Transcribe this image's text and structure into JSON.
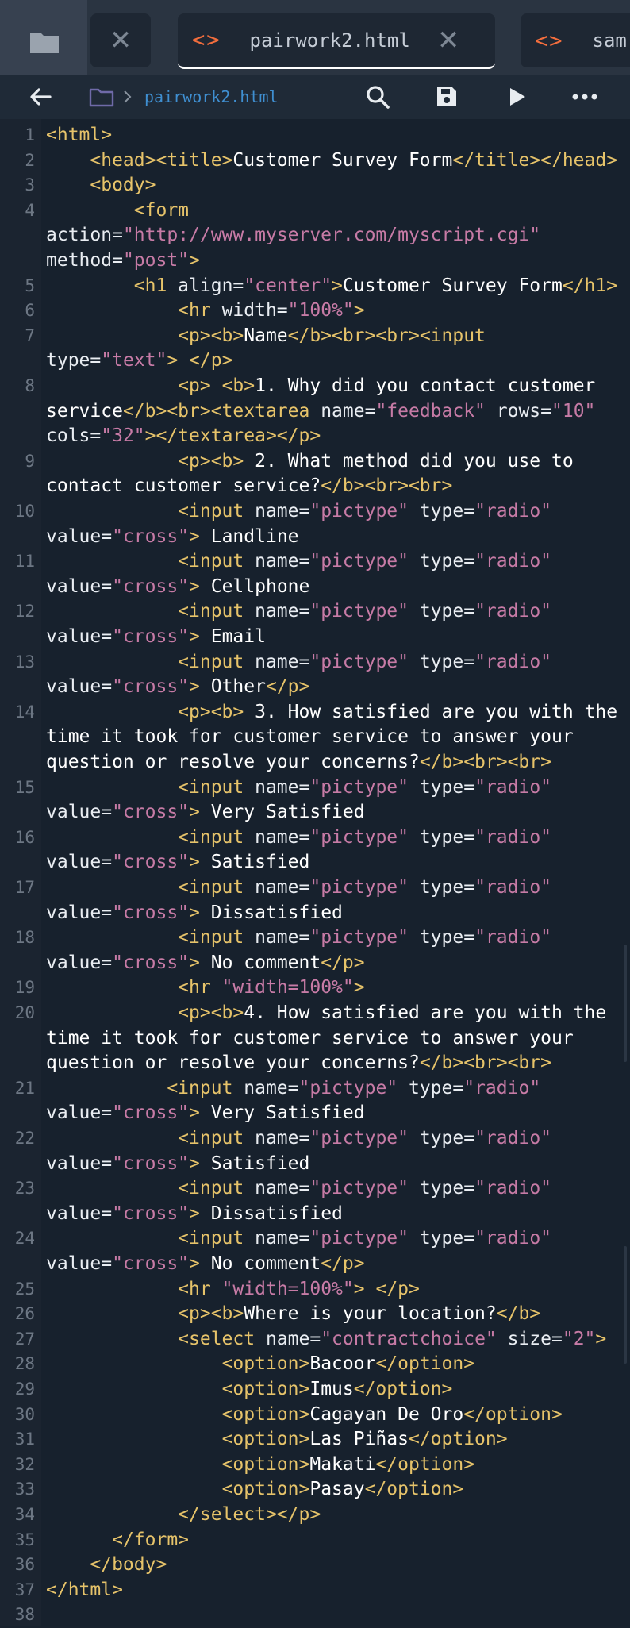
{
  "tabs": [
    {
      "label": "pairwork2.html",
      "active": true
    },
    {
      "label": "sam",
      "active": false
    }
  ],
  "toolbar": {
    "breadcrumb_label": "pairwork2.html"
  },
  "editor": {
    "lines": [
      {
        "n": "1",
        "tokens": [
          [
            "t",
            "<html>"
          ]
        ]
      },
      {
        "n": "2",
        "tokens": [
          [
            "x",
            "    "
          ],
          [
            "t",
            "<head><title>"
          ],
          [
            "x",
            "Customer Survey Form"
          ],
          [
            "t",
            "</title></head>"
          ]
        ]
      },
      {
        "n": "3",
        "tokens": [
          [
            "x",
            "    "
          ],
          [
            "t",
            "<body>"
          ]
        ]
      },
      {
        "n": "4",
        "tokens": [
          [
            "x",
            "        "
          ],
          [
            "t",
            "<form"
          ],
          [
            "x",
            "\n"
          ],
          [
            "a",
            "action="
          ],
          [
            "s",
            "\"http://www.myserver.com/myscript.cgi\""
          ],
          [
            "x",
            "\n"
          ],
          [
            "a",
            "method="
          ],
          [
            "s",
            "\"post\""
          ],
          [
            "t",
            ">"
          ]
        ]
      },
      {
        "n": "5",
        "tokens": [
          [
            "x",
            "        "
          ],
          [
            "t",
            "<h1"
          ],
          [
            "a",
            " align="
          ],
          [
            "s",
            "\"center\""
          ],
          [
            "t",
            ">"
          ],
          [
            "x",
            "Customer Survey Form"
          ],
          [
            "t",
            "</h1>"
          ]
        ]
      },
      {
        "n": "6",
        "tokens": [
          [
            "x",
            "            "
          ],
          [
            "t",
            "<hr"
          ],
          [
            "a",
            " width="
          ],
          [
            "s",
            "\"100%\""
          ],
          [
            "t",
            ">"
          ]
        ]
      },
      {
        "n": "7",
        "tokens": [
          [
            "x",
            "            "
          ],
          [
            "t",
            "<p><b>"
          ],
          [
            "x",
            "Name"
          ],
          [
            "t",
            "</b><br><br><input"
          ],
          [
            "x",
            "\n"
          ],
          [
            "a",
            "type="
          ],
          [
            "s",
            "\"text\""
          ],
          [
            "t",
            ">"
          ],
          [
            "x",
            " "
          ],
          [
            "t",
            "</p>"
          ]
        ]
      },
      {
        "n": "8",
        "tokens": [
          [
            "x",
            "            "
          ],
          [
            "t",
            "<p>"
          ],
          [
            "x",
            " "
          ],
          [
            "t",
            "<b>"
          ],
          [
            "x",
            "1. Why did you contact customer service"
          ],
          [
            "t",
            "</b><br><textarea"
          ],
          [
            "a",
            " name="
          ],
          [
            "s",
            "\"feedback\""
          ],
          [
            "a",
            " rows="
          ],
          [
            "s",
            "\"10\""
          ],
          [
            "x",
            "\n"
          ],
          [
            "a",
            "cols="
          ],
          [
            "s",
            "\"32\""
          ],
          [
            "t",
            "></textarea></p>"
          ]
        ]
      },
      {
        "n": "9",
        "tokens": [
          [
            "x",
            "            "
          ],
          [
            "t",
            "<p><b>"
          ],
          [
            "x",
            " 2. What method did you use to contact customer service?"
          ],
          [
            "t",
            "</b><br><br>"
          ]
        ]
      },
      {
        "n": "10",
        "tokens": [
          [
            "x",
            "            "
          ],
          [
            "t",
            "<input"
          ],
          [
            "a",
            " name="
          ],
          [
            "s",
            "\"pictype\""
          ],
          [
            "a",
            " type="
          ],
          [
            "s",
            "\"radio\""
          ],
          [
            "x",
            "\n"
          ],
          [
            "a",
            "value="
          ],
          [
            "s",
            "\"cross\""
          ],
          [
            "t",
            ">"
          ],
          [
            "x",
            " Landline"
          ]
        ]
      },
      {
        "n": "11",
        "tokens": [
          [
            "x",
            "            "
          ],
          [
            "t",
            "<input"
          ],
          [
            "a",
            " name="
          ],
          [
            "s",
            "\"pictype\""
          ],
          [
            "a",
            " type="
          ],
          [
            "s",
            "\"radio\""
          ],
          [
            "x",
            "\n"
          ],
          [
            "a",
            "value="
          ],
          [
            "s",
            "\"cross\""
          ],
          [
            "t",
            ">"
          ],
          [
            "x",
            " Cellphone"
          ]
        ]
      },
      {
        "n": "12",
        "tokens": [
          [
            "x",
            "            "
          ],
          [
            "t",
            "<input"
          ],
          [
            "a",
            " name="
          ],
          [
            "s",
            "\"pictype\""
          ],
          [
            "a",
            " type="
          ],
          [
            "s",
            "\"radio\""
          ],
          [
            "x",
            "\n"
          ],
          [
            "a",
            "value="
          ],
          [
            "s",
            "\"cross\""
          ],
          [
            "t",
            ">"
          ],
          [
            "x",
            " Email"
          ]
        ]
      },
      {
        "n": "13",
        "tokens": [
          [
            "x",
            "            "
          ],
          [
            "t",
            "<input"
          ],
          [
            "a",
            " name="
          ],
          [
            "s",
            "\"pictype\""
          ],
          [
            "a",
            " type="
          ],
          [
            "s",
            "\"radio\""
          ],
          [
            "x",
            "\n"
          ],
          [
            "a",
            "value="
          ],
          [
            "s",
            "\"cross\""
          ],
          [
            "t",
            ">"
          ],
          [
            "x",
            " Other"
          ],
          [
            "t",
            "</p>"
          ]
        ]
      },
      {
        "n": "14",
        "tokens": [
          [
            "x",
            "            "
          ],
          [
            "t",
            "<p><b>"
          ],
          [
            "x",
            " 3. How satisfied are you with the time it took for customer service to answer your question or resolve your concerns?"
          ],
          [
            "t",
            "</b><br><br>"
          ]
        ]
      },
      {
        "n": "15",
        "tokens": [
          [
            "x",
            "            "
          ],
          [
            "t",
            "<input"
          ],
          [
            "a",
            " name="
          ],
          [
            "s",
            "\"pictype\""
          ],
          [
            "a",
            " type="
          ],
          [
            "s",
            "\"radio\""
          ],
          [
            "x",
            "\n"
          ],
          [
            "a",
            "value="
          ],
          [
            "s",
            "\"cross\""
          ],
          [
            "t",
            ">"
          ],
          [
            "x",
            " Very Satisfied"
          ]
        ]
      },
      {
        "n": "16",
        "tokens": [
          [
            "x",
            "            "
          ],
          [
            "t",
            "<input"
          ],
          [
            "a",
            " name="
          ],
          [
            "s",
            "\"pictype\""
          ],
          [
            "a",
            " type="
          ],
          [
            "s",
            "\"radio\""
          ],
          [
            "x",
            "\n"
          ],
          [
            "a",
            "value="
          ],
          [
            "s",
            "\"cross\""
          ],
          [
            "t",
            ">"
          ],
          [
            "x",
            " Satisfied"
          ]
        ]
      },
      {
        "n": "17",
        "tokens": [
          [
            "x",
            "            "
          ],
          [
            "t",
            "<input"
          ],
          [
            "a",
            " name="
          ],
          [
            "s",
            "\"pictype\""
          ],
          [
            "a",
            " type="
          ],
          [
            "s",
            "\"radio\""
          ],
          [
            "x",
            "\n"
          ],
          [
            "a",
            "value="
          ],
          [
            "s",
            "\"cross\""
          ],
          [
            "t",
            ">"
          ],
          [
            "x",
            " Dissatisfied"
          ]
        ]
      },
      {
        "n": "18",
        "tokens": [
          [
            "x",
            "            "
          ],
          [
            "t",
            "<input"
          ],
          [
            "a",
            " name="
          ],
          [
            "s",
            "\"pictype\""
          ],
          [
            "a",
            " type="
          ],
          [
            "s",
            "\"radio\""
          ],
          [
            "x",
            "\n"
          ],
          [
            "a",
            "value="
          ],
          [
            "s",
            "\"cross\""
          ],
          [
            "t",
            ">"
          ],
          [
            "x",
            " No comment"
          ],
          [
            "t",
            "</p>"
          ]
        ]
      },
      {
        "n": "19",
        "tokens": [
          [
            "x",
            "            "
          ],
          [
            "t",
            "<hr"
          ],
          [
            "x",
            " "
          ],
          [
            "s",
            "\"width=100%\""
          ],
          [
            "t",
            ">"
          ]
        ]
      },
      {
        "n": "20",
        "tokens": [
          [
            "x",
            "            "
          ],
          [
            "t",
            "<p><b>"
          ],
          [
            "x",
            "4. How satisfied are you with the time it took for customer service to answer your question or resolve your concerns?"
          ],
          [
            "t",
            "</b><br><br>"
          ]
        ]
      },
      {
        "n": "21",
        "tokens": [
          [
            "x",
            "           "
          ],
          [
            "t",
            "<input"
          ],
          [
            "a",
            " name="
          ],
          [
            "s",
            "\"pictype\""
          ],
          [
            "a",
            " type="
          ],
          [
            "s",
            "\"radio\""
          ],
          [
            "x",
            "\n"
          ],
          [
            "a",
            "value="
          ],
          [
            "s",
            "\"cross\""
          ],
          [
            "t",
            ">"
          ],
          [
            "x",
            " Very Satisfied"
          ]
        ]
      },
      {
        "n": "22",
        "tokens": [
          [
            "x",
            "            "
          ],
          [
            "t",
            "<input"
          ],
          [
            "a",
            " name="
          ],
          [
            "s",
            "\"pictype\""
          ],
          [
            "a",
            " type="
          ],
          [
            "s",
            "\"radio\""
          ],
          [
            "x",
            "\n"
          ],
          [
            "a",
            "value="
          ],
          [
            "s",
            "\"cross\""
          ],
          [
            "t",
            ">"
          ],
          [
            "x",
            " Satisfied"
          ]
        ]
      },
      {
        "n": "23",
        "tokens": [
          [
            "x",
            "            "
          ],
          [
            "t",
            "<input"
          ],
          [
            "a",
            " name="
          ],
          [
            "s",
            "\"pictype\""
          ],
          [
            "a",
            " type="
          ],
          [
            "s",
            "\"radio\""
          ],
          [
            "x",
            "\n"
          ],
          [
            "a",
            "value="
          ],
          [
            "s",
            "\"cross\""
          ],
          [
            "t",
            ">"
          ],
          [
            "x",
            " Dissatisfied"
          ]
        ]
      },
      {
        "n": "24",
        "tokens": [
          [
            "x",
            "            "
          ],
          [
            "t",
            "<input"
          ],
          [
            "a",
            " name="
          ],
          [
            "s",
            "\"pictype\""
          ],
          [
            "a",
            " type="
          ],
          [
            "s",
            "\"radio\""
          ],
          [
            "x",
            "\n"
          ],
          [
            "a",
            "value="
          ],
          [
            "s",
            "\"cross\""
          ],
          [
            "t",
            ">"
          ],
          [
            "x",
            " No comment"
          ],
          [
            "t",
            "</p>"
          ]
        ]
      },
      {
        "n": "25",
        "tokens": [
          [
            "x",
            "            "
          ],
          [
            "t",
            "<hr"
          ],
          [
            "x",
            " "
          ],
          [
            "s",
            "\"width=100%\""
          ],
          [
            "t",
            ">"
          ],
          [
            "x",
            " "
          ],
          [
            "t",
            "</p>"
          ]
        ]
      },
      {
        "n": "26",
        "tokens": [
          [
            "x",
            "            "
          ],
          [
            "t",
            "<p><b>"
          ],
          [
            "x",
            "Where is your location?"
          ],
          [
            "t",
            "</b>"
          ]
        ]
      },
      {
        "n": "27",
        "tokens": [
          [
            "x",
            "            "
          ],
          [
            "t",
            "<select"
          ],
          [
            "a",
            " name="
          ],
          [
            "s",
            "\"contractchoice\""
          ],
          [
            "a",
            " size="
          ],
          [
            "s",
            "\"2\""
          ],
          [
            "t",
            ">"
          ]
        ]
      },
      {
        "n": "28",
        "tokens": [
          [
            "x",
            "                "
          ],
          [
            "t",
            "<option>"
          ],
          [
            "x",
            "Bacoor"
          ],
          [
            "t",
            "</option>"
          ]
        ]
      },
      {
        "n": "29",
        "tokens": [
          [
            "x",
            "                "
          ],
          [
            "t",
            "<option>"
          ],
          [
            "x",
            "Imus"
          ],
          [
            "t",
            "</option>"
          ]
        ]
      },
      {
        "n": "30",
        "tokens": [
          [
            "x",
            "                "
          ],
          [
            "t",
            "<option>"
          ],
          [
            "x",
            "Cagayan De Oro"
          ],
          [
            "t",
            "</option>"
          ]
        ]
      },
      {
        "n": "31",
        "tokens": [
          [
            "x",
            "                "
          ],
          [
            "t",
            "<option>"
          ],
          [
            "x",
            "Las Piñas"
          ],
          [
            "t",
            "</option>"
          ]
        ]
      },
      {
        "n": "32",
        "tokens": [
          [
            "x",
            "                "
          ],
          [
            "t",
            "<option>"
          ],
          [
            "x",
            "Makati"
          ],
          [
            "t",
            "</option>"
          ]
        ]
      },
      {
        "n": "33",
        "tokens": [
          [
            "x",
            "                "
          ],
          [
            "t",
            "<option>"
          ],
          [
            "x",
            "Pasay"
          ],
          [
            "t",
            "</option>"
          ]
        ]
      },
      {
        "n": "34",
        "tokens": [
          [
            "x",
            "            "
          ],
          [
            "t",
            "</select></p>"
          ]
        ]
      },
      {
        "n": "35",
        "tokens": [
          [
            "x",
            "      "
          ],
          [
            "t",
            "</form>"
          ]
        ]
      },
      {
        "n": "36",
        "tokens": [
          [
            "x",
            "    "
          ],
          [
            "t",
            "</body>"
          ]
        ]
      },
      {
        "n": "37",
        "tokens": [
          [
            "t",
            "</html>"
          ]
        ]
      },
      {
        "n": "38",
        "tokens": []
      }
    ]
  },
  "colors": {
    "tag": "#e6c36a",
    "string": "#c77ba6",
    "text": "#ffffff",
    "accent": "#f26d3d",
    "link": "#3f8fd1"
  }
}
